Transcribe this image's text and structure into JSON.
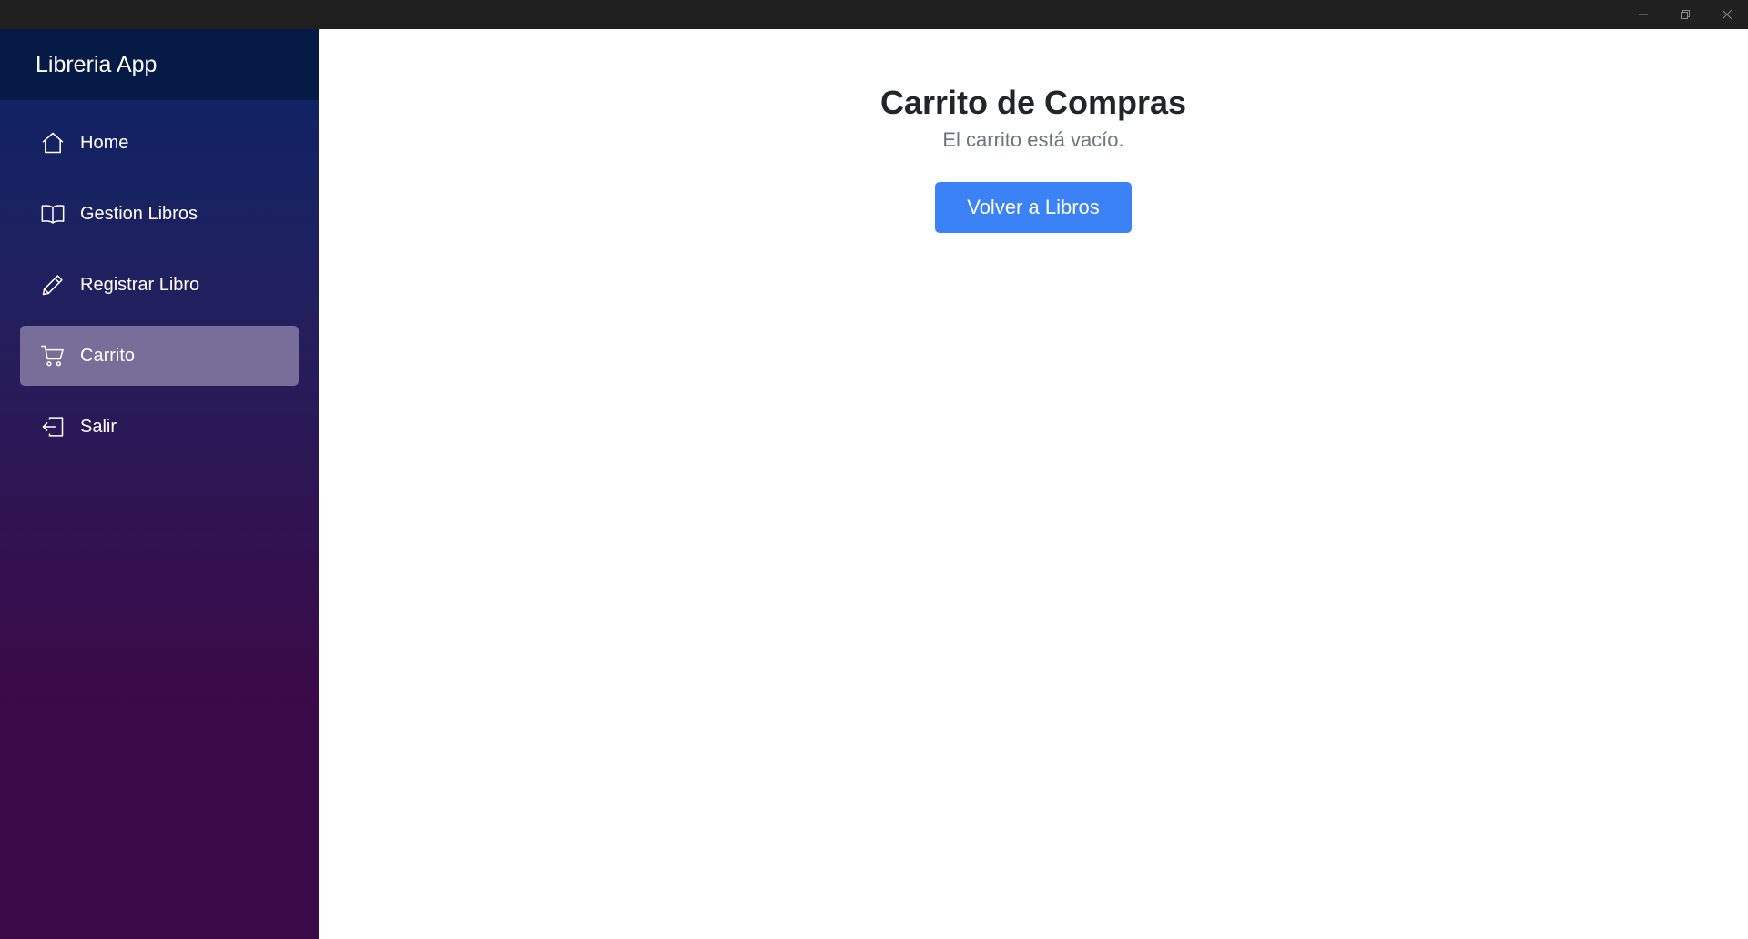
{
  "window": {
    "controls": [
      {
        "name": "minimize",
        "icon": "minimize-icon"
      },
      {
        "name": "restore",
        "icon": "restore-icon"
      },
      {
        "name": "close",
        "icon": "close-icon"
      }
    ]
  },
  "sidebar": {
    "brand": "Libreria App",
    "items": [
      {
        "label": "Home",
        "icon": "home-icon",
        "active": false
      },
      {
        "label": "Gestion Libros",
        "icon": "book-open-icon",
        "active": false
      },
      {
        "label": "Registrar Libro",
        "icon": "pencil-icon",
        "active": false
      },
      {
        "label": "Carrito",
        "icon": "cart-icon",
        "active": true
      },
      {
        "label": "Salir",
        "icon": "exit-icon",
        "active": false
      }
    ]
  },
  "main": {
    "title": "Carrito de Compras",
    "message": "El carrito está vacío.",
    "back_button": "Volver a Libros"
  },
  "colors": {
    "primary_button": "#3b82f6",
    "active_nav": "#776e9a",
    "sidebar_top": "#0b2466",
    "sidebar_bottom": "#3b0a47",
    "brand_bar": "#051a45",
    "titlebar": "#202020"
  }
}
